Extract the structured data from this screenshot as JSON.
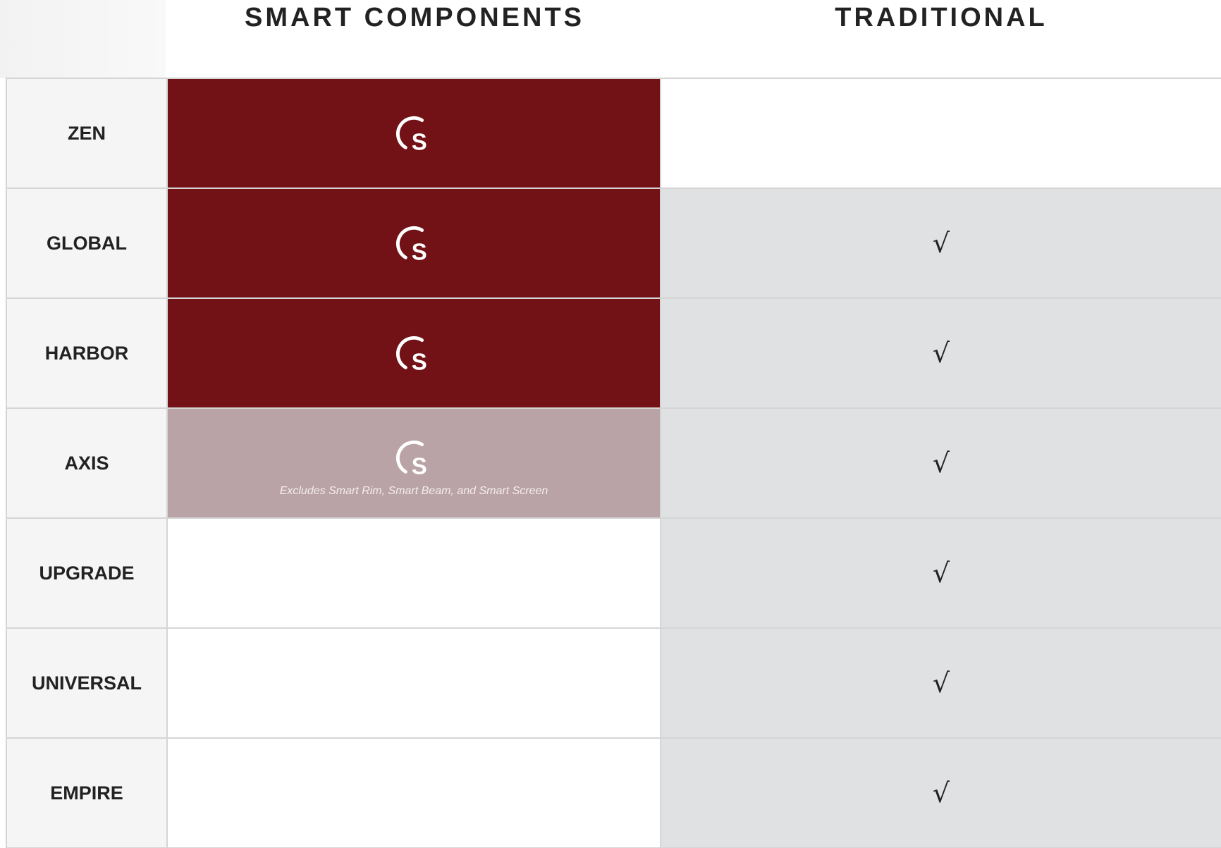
{
  "header": {
    "smart_title": "SMART COMPONENTS",
    "traditional_title": "TRADITIONAL"
  },
  "colors": {
    "smart_full": "#731216",
    "smart_partial": "#b9a3a7",
    "traditional_checked": "#e0e1e3",
    "label_bg": "#f5f5f5"
  },
  "rows": [
    {
      "label": "ZEN",
      "smart": "full",
      "smart_note": "",
      "traditional": "",
      "traditional_state": "empty"
    },
    {
      "label": "GLOBAL",
      "smart": "full",
      "smart_note": "",
      "traditional": "√",
      "traditional_state": "checked"
    },
    {
      "label": "HARBOR",
      "smart": "full",
      "smart_note": "",
      "traditional": "√",
      "traditional_state": "checked"
    },
    {
      "label": "AXIS",
      "smart": "partial",
      "smart_note": "Excludes Smart Rim, Smart Beam, and Smart Screen",
      "traditional": "√",
      "traditional_state": "checked"
    },
    {
      "label": "UPGRADE",
      "smart": "none",
      "smart_note": "",
      "traditional": "√",
      "traditional_state": "checked"
    },
    {
      "label": "UNIVERSAL",
      "smart": "none",
      "smart_note": "",
      "traditional": "√",
      "traditional_state": "checked"
    },
    {
      "label": "EMPIRE",
      "smart": "none",
      "smart_note": "",
      "traditional": "√",
      "traditional_state": "checked"
    }
  ],
  "icons": {
    "smart": "smart-s-logo-icon",
    "check": "check-icon"
  }
}
